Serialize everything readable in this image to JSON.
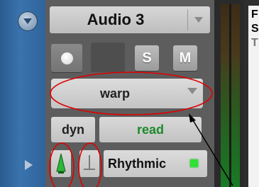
{
  "track": {
    "name": "Audio 3"
  },
  "buttons": {
    "solo": "S",
    "mute": "M"
  },
  "elastic": {
    "mode": "warp"
  },
  "automation": {
    "view": "dyn",
    "mode": "read"
  },
  "warp_plugin": {
    "label": "Rhythmic"
  },
  "right_panel": {
    "letters": [
      "F",
      "S",
      "T"
    ]
  },
  "colors": {
    "strip_blue": "#3a73ad",
    "automation_read_green": "#1d8a2a",
    "led_green": "#2fe236",
    "annotation_red": "#e00000"
  }
}
